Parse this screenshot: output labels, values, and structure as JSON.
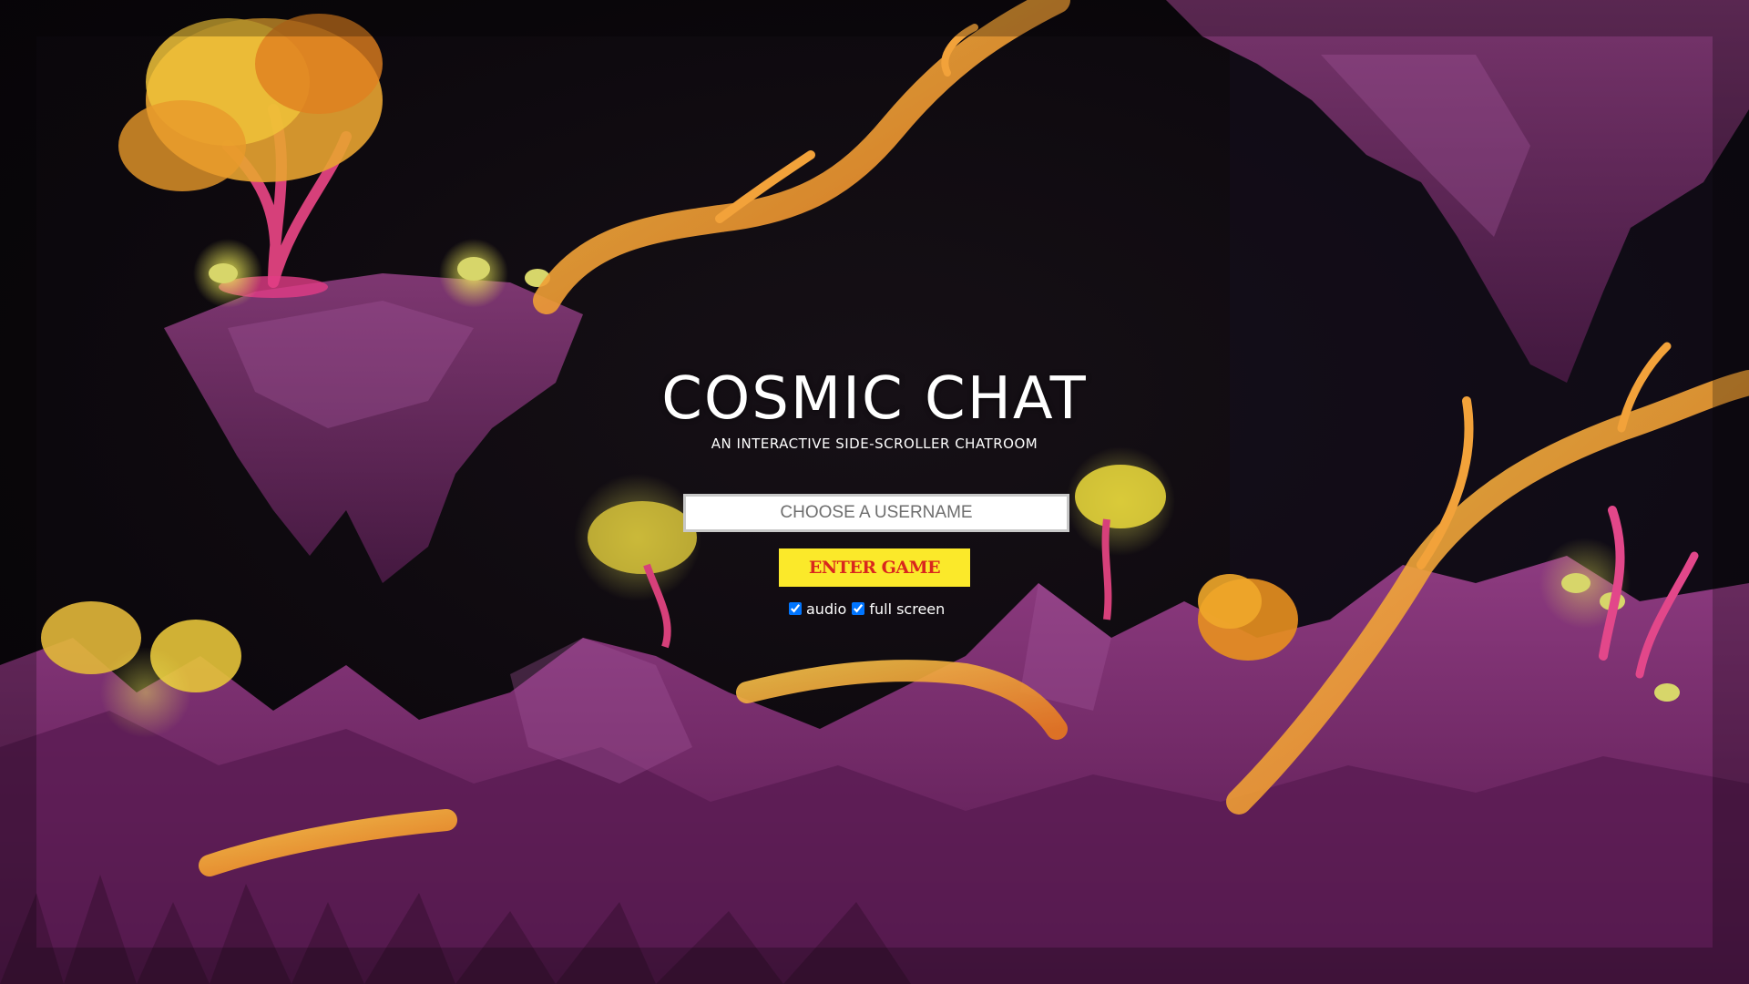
{
  "game": {
    "title": "COSMIC CHAT",
    "subtitle": "AN INTERACTIVE SIDE-SCROLLER CHATROOM"
  },
  "login": {
    "username_placeholder": "CHOOSE A USERNAME",
    "username_value": "",
    "enter_label": "ENTER GAME"
  },
  "options": {
    "audio_label": "audio",
    "audio_checked": true,
    "fullscreen_label": "full screen",
    "fullscreen_checked": true
  },
  "colors": {
    "sky": "#0a070c",
    "rock": "#6b2a63",
    "branch": "#f2a23a",
    "foliage": "#e7c63a",
    "button_bg": "#fbe92a",
    "button_text": "#d9271d"
  }
}
